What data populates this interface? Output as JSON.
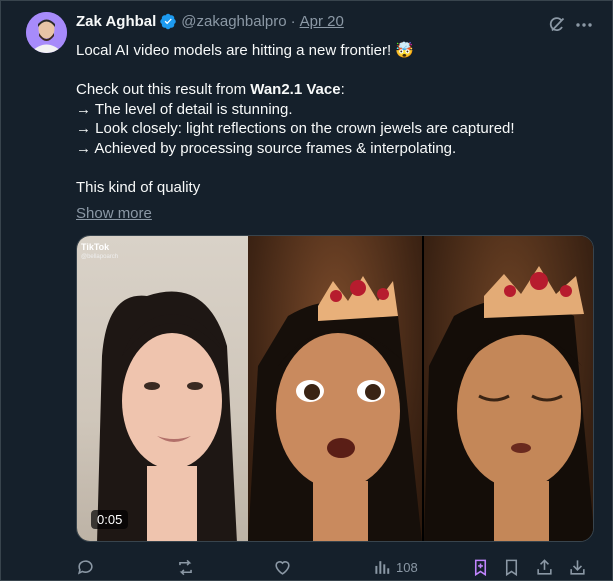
{
  "author": {
    "name": "Zak Aghbal",
    "handle": "@zakaghbalpro",
    "separator": "·",
    "date": "Apr 20"
  },
  "tweet": {
    "line1": "Local AI video models are hitting a new frontier! 🤯",
    "line2_prefix": "Check out this result from ",
    "line2_bold": "Wan2.1 Vace",
    "line2_suffix": ":",
    "line3": "→ The level of detail is stunning.",
    "line4": "→ Look closely: light reflections on the crown jewels are captured!",
    "line5": "→ Achieved by processing source frames & interpolating.",
    "line6": "This kind of quality",
    "show_more": "Show more"
  },
  "media": {
    "watermark": "TikTok",
    "watermark_user": "@bellapoarch",
    "duration": "0:05"
  },
  "actions": {
    "views": "108"
  },
  "colors": {
    "background": "#15202b",
    "text": "#f7f9f9",
    "muted": "#8b98a5",
    "verified": "#1d9bf0",
    "bookmark_accent": "#c084fc"
  }
}
